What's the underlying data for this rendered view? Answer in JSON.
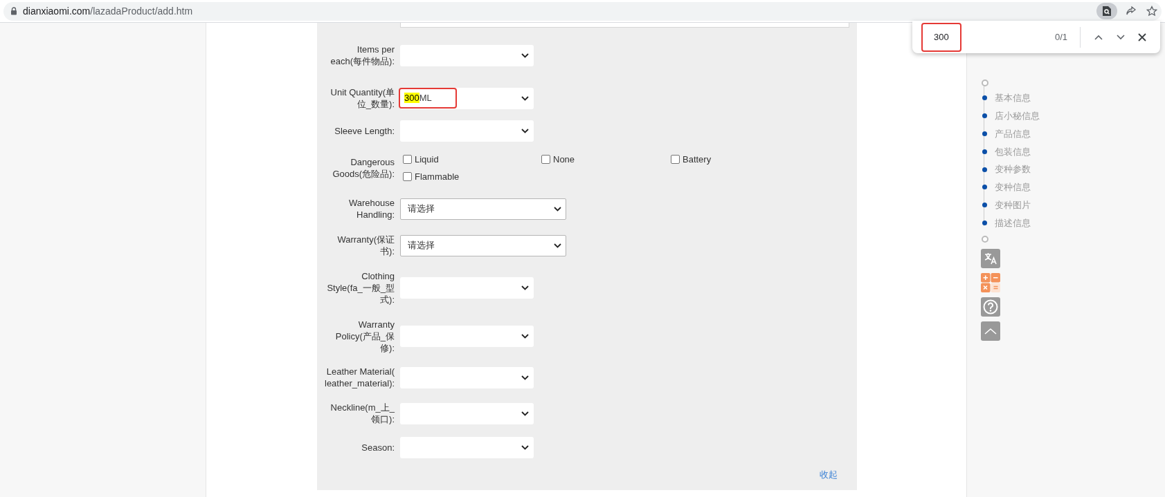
{
  "address_bar": {
    "host": "dianxiaomi.com",
    "path": "/lazadaProduct/add.htm"
  },
  "find_bar": {
    "query": "300",
    "annotated": true,
    "count": "0/1"
  },
  "form": {
    "rows": [
      {
        "kind": "dropdown",
        "label": "Items per each(每件物品):"
      },
      {
        "kind": "dropdown",
        "label": "Unit Quantity(单位_数量):",
        "annotated": true,
        "value_parts": [
          {
            "text": "300",
            "highlighted": true
          },
          {
            "text": "ML",
            "highlighted": false
          }
        ]
      },
      {
        "kind": "dropdown",
        "label": "Sleeve Length:"
      },
      {
        "kind": "checkboxes",
        "label": "Dangerous Goods(危险品):",
        "options": [
          {
            "label": "Liquid",
            "checked": false
          },
          {
            "label": "None",
            "checked": false
          },
          {
            "label": "Battery",
            "checked": false
          },
          {
            "label": "Flammable",
            "checked": false
          }
        ]
      },
      {
        "kind": "wide-dropdown",
        "label": "Warehouse Handling:",
        "value": "请选择"
      },
      {
        "kind": "wide-dropdown",
        "label": "Warranty(保证书):",
        "value": "请选择"
      },
      {
        "kind": "dropdown",
        "label": "Clothing Style(fa_一般_型式):"
      },
      {
        "kind": "dropdown",
        "label": "Warranty Policy(产品_保修):"
      },
      {
        "kind": "dropdown",
        "label": "Leather Material( leather_material):"
      },
      {
        "kind": "dropdown",
        "label": "Neckline(m_上_领口):"
      },
      {
        "kind": "dropdown",
        "label": "Season:"
      }
    ],
    "collapse_link": "收起"
  },
  "section_nav": {
    "items": [
      "基本信息",
      "店小秘信息",
      "产品信息",
      "包装信息",
      "变种参数",
      "变种信息",
      "变种图片",
      "描述信息"
    ]
  }
}
